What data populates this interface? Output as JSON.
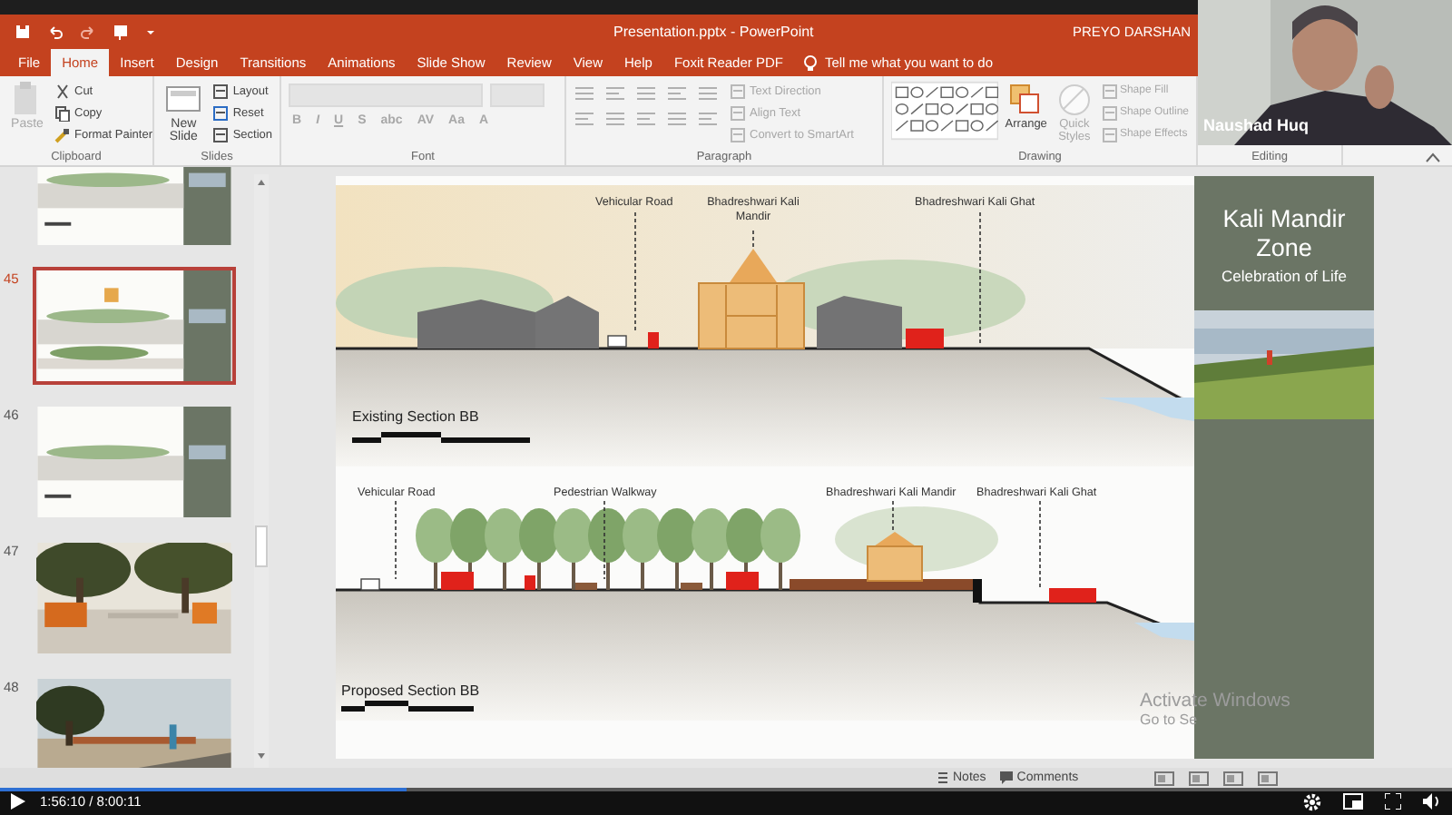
{
  "title_bar": {
    "title": "Presentation.pptx  -  PowerPoint",
    "user": "PREYO DARSHAN"
  },
  "tabs": [
    {
      "label": "File",
      "selected": false
    },
    {
      "label": "Home",
      "selected": true
    },
    {
      "label": "Insert",
      "selected": false
    },
    {
      "label": "Design",
      "selected": false
    },
    {
      "label": "Transitions",
      "selected": false
    },
    {
      "label": "Animations",
      "selected": false
    },
    {
      "label": "Slide Show",
      "selected": false
    },
    {
      "label": "Review",
      "selected": false
    },
    {
      "label": "View",
      "selected": false
    },
    {
      "label": "Help",
      "selected": false
    },
    {
      "label": "Foxit Reader PDF",
      "selected": false
    }
  ],
  "tell_me": {
    "placeholder": "Tell me what you want to do"
  },
  "ribbon": [
    {
      "label": "Clipboard",
      "kind": "commands",
      "large": [
        {
          "label": "Paste",
          "disabled": true
        }
      ],
      "small": [
        {
          "label": "Cut",
          "disabled": false
        },
        {
          "label": "Copy",
          "disabled": false
        },
        {
          "label": "Format Painter",
          "disabled": false
        }
      ]
    },
    {
      "label": "Slides",
      "kind": "commands",
      "large": [
        {
          "label": "New Slide",
          "disabled": false
        }
      ],
      "small": [
        {
          "label": "Layout",
          "disabled": false
        },
        {
          "label": "Reset",
          "disabled": false
        },
        {
          "label": "Section",
          "disabled": false
        }
      ]
    },
    {
      "label": "Font",
      "kind": "font",
      "buttons": [
        {
          "label": "B",
          "disabled": true
        },
        {
          "label": "I",
          "disabled": true
        },
        {
          "label": "U",
          "disabled": true
        },
        {
          "label": "S",
          "disabled": true
        },
        {
          "label": "abc",
          "disabled": true
        },
        {
          "label": "AV",
          "disabled": true
        },
        {
          "label": "Aa",
          "disabled": true
        },
        {
          "label": "A",
          "disabled": true
        }
      ]
    },
    {
      "label": "Paragraph",
      "kind": "paragraph",
      "small": [
        {
          "label": "Text Direction",
          "disabled": true
        },
        {
          "label": "Align Text",
          "disabled": true
        },
        {
          "label": "Convert to SmartArt",
          "disabled": true
        }
      ]
    },
    {
      "label": "Drawing",
      "kind": "drawing",
      "large": [
        {
          "label": "Arrange",
          "disabled": false
        },
        {
          "label": "Quick Styles",
          "disabled": true
        }
      ],
      "small": [
        {
          "label": "Shape Fill",
          "disabled": true
        },
        {
          "label": "Shape Outline",
          "disabled": true
        },
        {
          "label": "Shape Effects",
          "disabled": true
        }
      ]
    },
    {
      "label": "Editing",
      "kind": "commands"
    }
  ],
  "thumbnails": [
    {
      "selected": false
    },
    {
      "number": "45",
      "selected": true
    },
    {
      "number": "46",
      "selected": false
    },
    {
      "number": "47",
      "selected": false
    },
    {
      "number": "48",
      "selected": false
    }
  ],
  "slide": {
    "side_panel": {
      "title": "Kali Mandir Zone",
      "subtitle": "Celebration of Life"
    },
    "sections": [
      {
        "caption": "Existing Section BB",
        "labels": [
          "Vehicular Road",
          "Bhadreshwari Kali Mandir",
          "Bhadreshwari Kali Ghat"
        ]
      },
      {
        "caption": "Proposed Section BB",
        "labels": [
          "Vehicular Road",
          "Pedestrian Walkway",
          "Bhadreshwari Kali Mandir",
          "Bhadreshwari Kali Ghat"
        ]
      }
    ]
  },
  "status_bar": {
    "buttons": [
      "Notes",
      "Comments"
    ]
  },
  "activation_notice": [
    "Activate Windows",
    "Go to Se"
  ],
  "video_tile": {
    "name": "Naushad Huq"
  },
  "player": {
    "time": "1:56:10 / 8:00:11",
    "progress": {
      "level": 0.28
    }
  }
}
